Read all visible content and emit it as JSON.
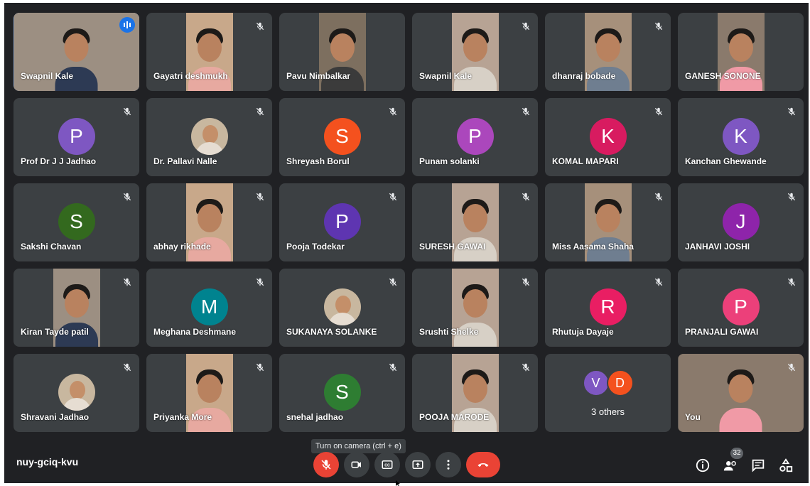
{
  "colors": {
    "background": "#202124",
    "tile": "#3c4043",
    "accent_blue": "#1a73e8",
    "danger": "#ea4335"
  },
  "tiles": [
    {
      "name": "Swapnil Kale",
      "kind": "video",
      "speaking": true
    },
    {
      "name": "Gayatri deshmukh",
      "kind": "video",
      "muted": true
    },
    {
      "name": "Pavu Nimbalkar",
      "kind": "video"
    },
    {
      "name": "Swapnil Kale",
      "kind": "video",
      "muted": true
    },
    {
      "name": "dhanraj bobade",
      "kind": "video",
      "muted": true
    },
    {
      "name": "GANESH SONONE",
      "kind": "video"
    },
    {
      "name": "Prof Dr J J Jadhao",
      "kind": "avatar",
      "letter": "P",
      "color": "#7e57c2",
      "muted": true
    },
    {
      "name": "Dr. Pallavi Nalle",
      "kind": "photo",
      "muted": true
    },
    {
      "name": "Shreyash Borul",
      "kind": "avatar",
      "letter": "S",
      "color": "#f4511e",
      "muted": true
    },
    {
      "name": "Punam solanki",
      "kind": "avatar",
      "letter": "P",
      "color": "#ab47bc",
      "muted": true
    },
    {
      "name": "KOMAL MAPARI",
      "kind": "avatar",
      "letter": "K",
      "color": "#d81b60",
      "muted": true
    },
    {
      "name": "Kanchan Ghewande",
      "kind": "avatar",
      "letter": "K",
      "color": "#7e57c2",
      "muted": true
    },
    {
      "name": "Sakshi Chavan",
      "kind": "avatar",
      "letter": "S",
      "color": "#33691e",
      "muted": true
    },
    {
      "name": "abhay rikhade",
      "kind": "video",
      "muted": true
    },
    {
      "name": "Pooja Todekar",
      "kind": "avatar",
      "letter": "P",
      "color": "#5e35b1",
      "muted": true
    },
    {
      "name": "SURESH GAWAI",
      "kind": "video",
      "muted": true
    },
    {
      "name": "Miss Aasama Shaha",
      "kind": "video",
      "muted": true
    },
    {
      "name": "JANHAVI JOSHI",
      "kind": "avatar",
      "letter": "J",
      "color": "#8e24aa",
      "muted": true
    },
    {
      "name": "Kiran Tayde patil",
      "kind": "video",
      "muted": true
    },
    {
      "name": "Meghana Deshmane",
      "kind": "avatar",
      "letter": "M",
      "color": "#00838f",
      "muted": true
    },
    {
      "name": "SUKANAYA SOLANKE",
      "kind": "photo",
      "muted": true
    },
    {
      "name": "Srushti Shelke",
      "kind": "video",
      "muted": true
    },
    {
      "name": "Rhutuja Dayaje",
      "kind": "avatar",
      "letter": "R",
      "color": "#e91e63",
      "muted": true
    },
    {
      "name": "PRANJALI GAWAI",
      "kind": "avatar",
      "letter": "P",
      "color": "#ec407a",
      "muted": true
    },
    {
      "name": "Shravani Jadhao",
      "kind": "photo",
      "muted": true
    },
    {
      "name": "Priyanka More",
      "kind": "video",
      "muted": true
    },
    {
      "name": "snehal jadhao",
      "kind": "avatar",
      "letter": "S",
      "color": "#2e7d32",
      "muted": true
    },
    {
      "name": "POOJA MARODE",
      "kind": "video",
      "muted": true
    },
    {
      "name": "",
      "kind": "others",
      "label": "3 others",
      "letters": [
        "V",
        "D"
      ],
      "colors": [
        "#7e57c2",
        "#f4511e"
      ]
    },
    {
      "name": "You",
      "kind": "self",
      "muted": true
    }
  ],
  "bottom": {
    "meeting_code": "nuy-gciq-kvu",
    "tooltip": "Turn on camera (ctrl + e)",
    "participant_count": "32",
    "controls": [
      "mic-off-icon",
      "camera-off-icon",
      "captions-icon",
      "present-icon",
      "more-options-icon",
      "leave-call-icon"
    ],
    "right_icons": [
      "info-icon",
      "people-icon",
      "chat-icon",
      "activities-icon"
    ]
  }
}
